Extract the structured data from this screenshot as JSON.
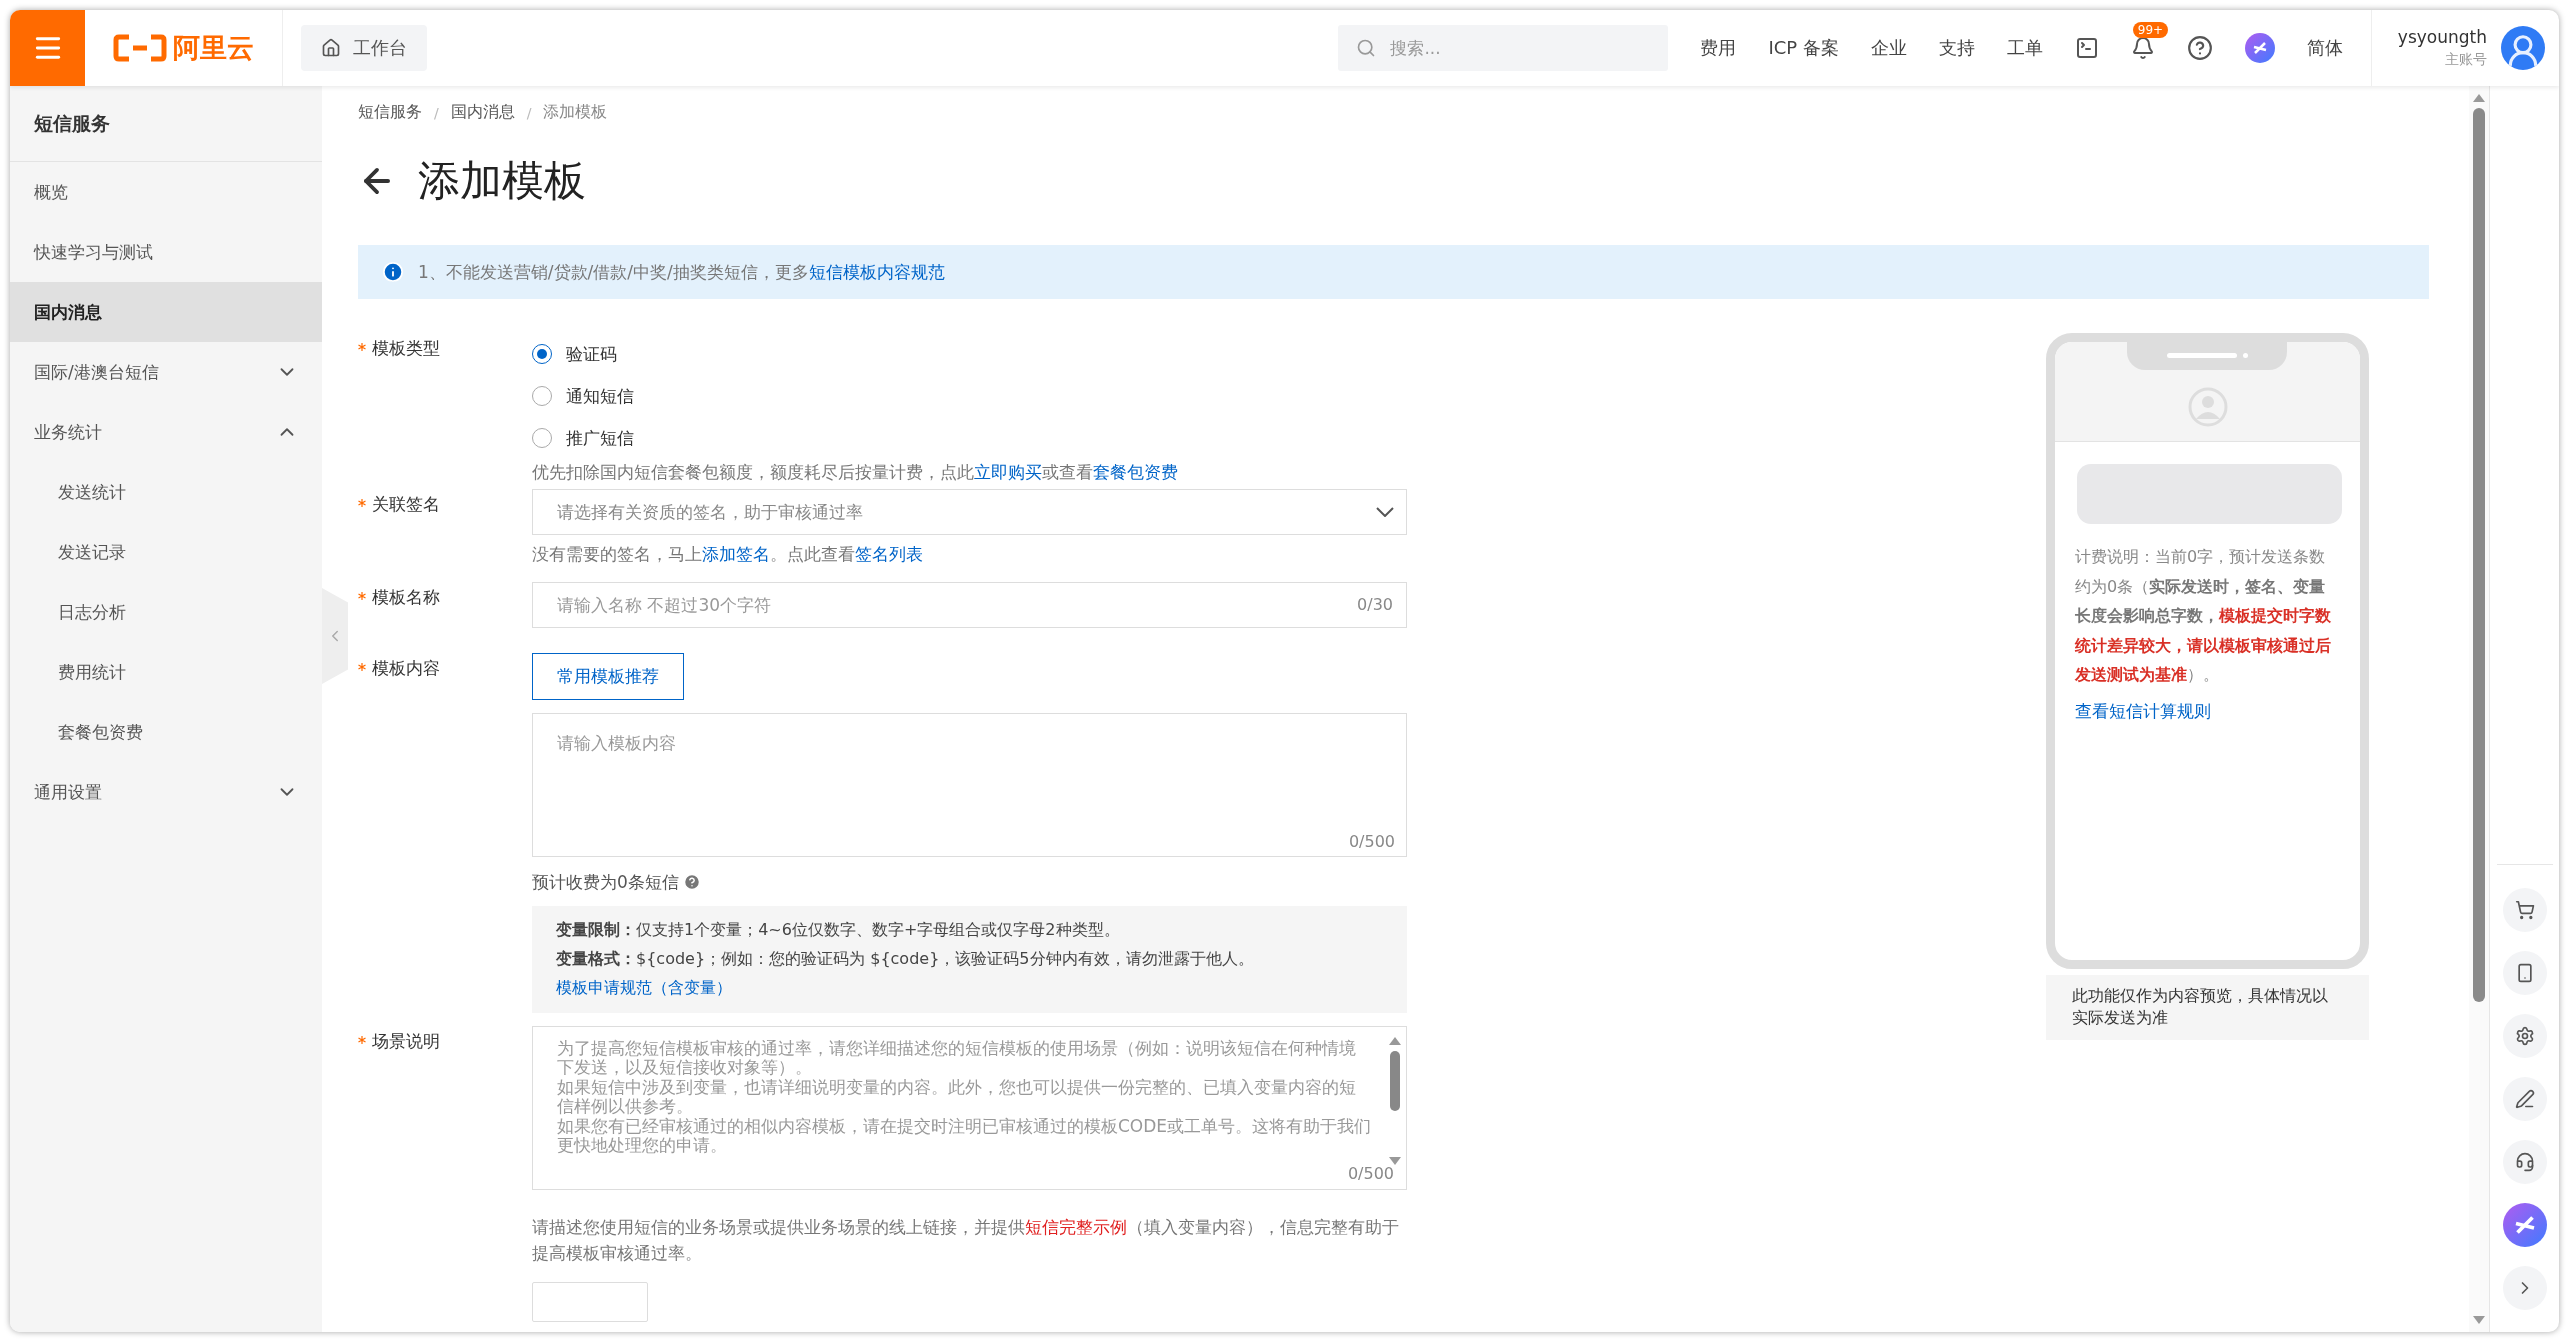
{
  "topbar": {
    "logo": "阿里云",
    "workbench": "工作台",
    "search": {
      "placeholder": "搜索..."
    },
    "nav": [
      "费用",
      "ICP 备案",
      "企业",
      "支持",
      "工单"
    ],
    "notification_badge": "99+",
    "language": "简体",
    "user": {
      "name": "ysyoungth",
      "role": "主账号"
    }
  },
  "sidebar": {
    "title": "短信服务",
    "items": [
      {
        "kind": "link",
        "label": "概览",
        "selected": false
      },
      {
        "kind": "link",
        "label": "快速学习与测试",
        "selected": false
      },
      {
        "kind": "link",
        "label": "国内消息",
        "selected": true
      },
      {
        "kind": "group",
        "label": "国际/港澳台短信",
        "expanded": false
      },
      {
        "kind": "group",
        "label": "业务统计",
        "expanded": true,
        "children": [
          {
            "label": "发送统计",
            "selected": false
          },
          {
            "label": "发送记录",
            "selected": false
          },
          {
            "label": "日志分析",
            "selected": false
          },
          {
            "label": "费用统计",
            "selected": false
          },
          {
            "label": "套餐包资费",
            "selected": false
          }
        ]
      },
      {
        "kind": "group",
        "label": "通用设置",
        "expanded": false
      }
    ]
  },
  "breadcrumb": {
    "separator": "/",
    "items": [
      "短信服务",
      "国内消息",
      "添加模板"
    ]
  },
  "title": "添加模板",
  "notice": [
    {
      "kind": "text",
      "text": "1、不能发送营销/贷款/借款/中奖/抽奖类短信，更多"
    },
    {
      "kind": "link",
      "text": "短信模板内容规范"
    }
  ],
  "form": {
    "template_type": {
      "label": "模板类型",
      "required": true,
      "options": [
        {
          "label": "验证码",
          "selected": true
        },
        {
          "label": "通知短信",
          "selected": false
        },
        {
          "label": "推广短信",
          "selected": false
        }
      ],
      "hint": [
        {
          "kind": "text",
          "text": "优先扣除国内短信套餐包额度，额度耗尽后按量计费，点此"
        },
        {
          "kind": "link",
          "text": "立即购买"
        },
        {
          "kind": "text",
          "text": "或查看"
        },
        {
          "kind": "link",
          "text": "套餐包资费"
        }
      ]
    },
    "signature": {
      "label": "关联签名",
      "required": true,
      "placeholder": "请选择有关资质的签名，助于审核通过率",
      "hint": [
        {
          "kind": "text",
          "text": "没有需要的签名，马上"
        },
        {
          "kind": "link",
          "text": "添加签名"
        },
        {
          "kind": "text",
          "text": "。点此查看"
        },
        {
          "kind": "link",
          "text": "签名列表"
        }
      ]
    },
    "name": {
      "label": "模板名称",
      "required": true,
      "placeholder": "请输入名称 不超过30个字符",
      "counter": "0/30"
    },
    "content": {
      "label": "模板内容",
      "required": true,
      "button": "常用模板推荐",
      "placeholder": "请输入模板内容",
      "counter": "0/500",
      "estimate": "预计收费为0条短信",
      "rules": [
        {
          "label": "变量限制：",
          "text": "仅支持1个变量；4~6位仅数字、数字+字母组合或仅字母2种类型。"
        },
        {
          "label": "变量格式：",
          "text": "${code}；例如：您的验证码为 ${code}，该验证码5分钟内有效，请勿泄露于他人。"
        }
      ],
      "rules_link": "模板申请规范（含变量）"
    },
    "scene": {
      "label": "场景说明",
      "required": true,
      "placeholder_paragraphs": [
        "为了提高您短信模板审核的通过率，请您详细描述您的短信模板的使用场景（例如：说明该短信在何种情境下发送，以及短信接收对象等）。",
        "如果短信中涉及到变量，也请详细说明变量的内容。此外，您也可以提供一份完整的、已填入变量内容的短信样例以供参考。",
        "如果您有已经审核通过的相似内容模板，请在提交时注明已审核通过的模板CODE或工单号。这将有助于我们更快地处理您的申请。"
      ],
      "counter": "0/500",
      "hint": [
        {
          "kind": "text",
          "text": "请描述您使用短信的业务场景或提供业务场景的线上链接，并提供"
        },
        {
          "kind": "red_link",
          "text": "短信完整示例"
        },
        {
          "kind": "text",
          "text": "（填入变量内容），信息完整有助于提高模板审核通过率。"
        }
      ]
    }
  },
  "preview": {
    "note": [
      {
        "kind": "plain",
        "text": "计费说明：当前0字，预计发送条数约为0条（"
      },
      {
        "kind": "bold",
        "text": "实际发送时，签名、变量长度会影响总字数，"
      },
      {
        "kind": "red",
        "text": "模板提交时字数统计差异较大，请以模板审核通过后发送测试为基准"
      },
      {
        "kind": "plain",
        "text": "）。"
      }
    ],
    "link": "查看短信计算规则",
    "disclaimer": "此功能仅作为内容预览，具体情况以实际发送为准"
  }
}
